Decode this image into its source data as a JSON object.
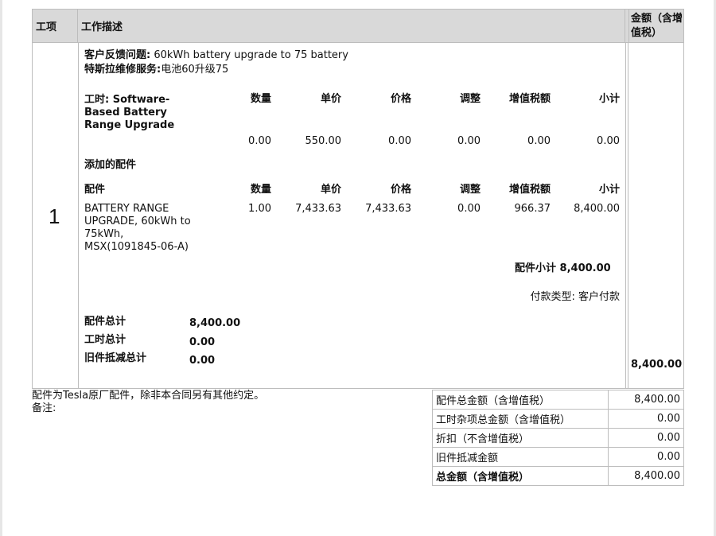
{
  "header": {
    "item_col": "工项",
    "desc_col": "工作描述",
    "amount_col": "金额（含增值税）"
  },
  "item": {
    "number": "1",
    "feedback_label": "客户反馈问题:",
    "feedback_value": "60kWh battery upgrade to 75 battery",
    "service_label": "特斯拉维修服务:",
    "service_value": "电池60升级75",
    "labor": {
      "label": "工时: Software-Based Battery Range Upgrade",
      "headers": [
        "数量",
        "单价",
        "价格",
        "调整",
        "增值税额",
        "小计"
      ],
      "values": [
        "0.00",
        "550.00",
        "0.00",
        "0.00",
        "0.00",
        "0.00"
      ]
    },
    "parts_section_title": "添加的配件",
    "parts": {
      "label": "配件",
      "headers": [
        "数量",
        "单价",
        "价格",
        "调整",
        "增值税额",
        "小计"
      ],
      "rows": [
        {
          "name": "BATTERY RANGE UPGRADE, 60kWh to 75kWh, MSX(1091845-06-A)",
          "values": [
            "1.00",
            "7,433.63",
            "7,433.63",
            "0.00",
            "966.37",
            "8,400.00"
          ]
        }
      ]
    },
    "parts_subtotal_label": "配件小计",
    "parts_subtotal_value": "8,400.00",
    "payment_type": "付款类型: 客户付款",
    "totals": [
      {
        "label": "配件总计",
        "value": "8,400.00"
      },
      {
        "label": "工时总计",
        "value": "0.00"
      },
      {
        "label": "旧件抵减总计",
        "value": "0.00"
      }
    ],
    "amount": "8,400.00"
  },
  "notes": {
    "line1": "配件为Tesla原厂配件，除非本合同另有其他约定。",
    "line2": "备注:"
  },
  "summary": [
    {
      "label": "配件总金额（含增值税）",
      "value": "8,400.00"
    },
    {
      "label": "工时杂项总金额（含增值税）",
      "value": "0.00"
    },
    {
      "label": "折扣（不含增值税）",
      "value": "0.00"
    },
    {
      "label": "旧件抵减金额",
      "value": "0.00"
    },
    {
      "label": "总金额（含增值税）",
      "value": "8,400.00"
    }
  ]
}
